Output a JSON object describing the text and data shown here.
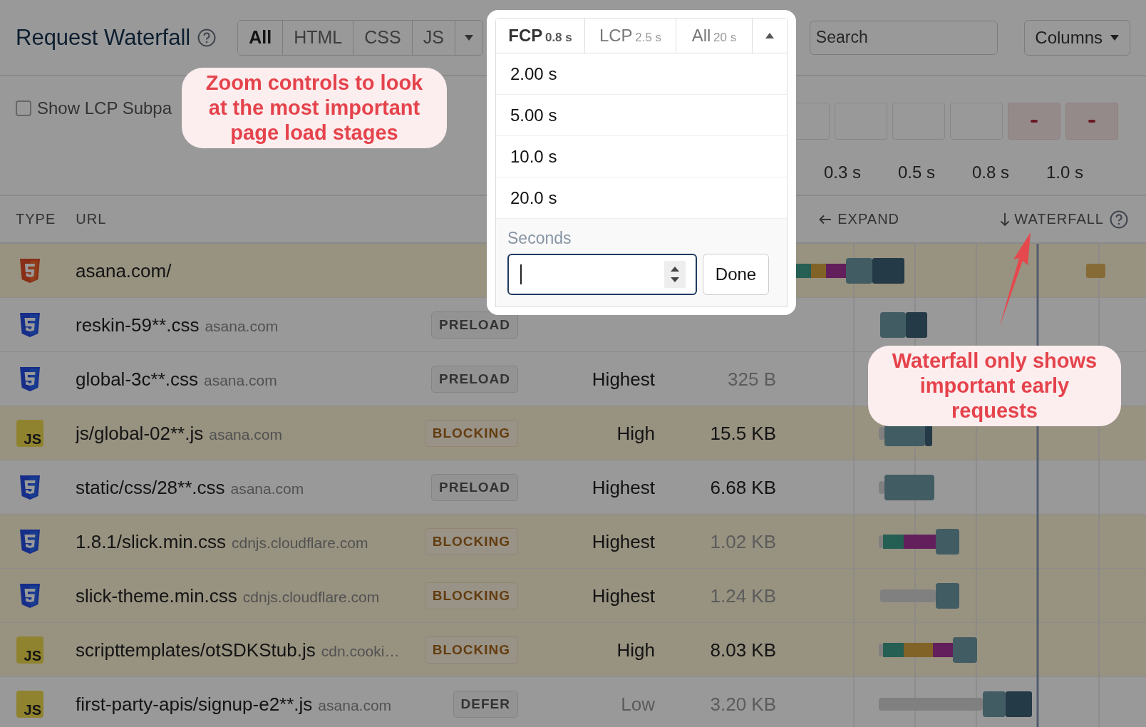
{
  "header": {
    "title": "Request Waterfall",
    "filters": [
      {
        "label": "All",
        "selected": true
      },
      {
        "label": "HTML",
        "selected": false
      },
      {
        "label": "CSS",
        "selected": false
      },
      {
        "label": "JS",
        "selected": false
      }
    ],
    "search": {
      "placeholder": "Search"
    },
    "columns_button": "Columns"
  },
  "lcp_toggle": {
    "label": "Show LCP Subpa",
    "checked": false
  },
  "filmstrip": [
    {
      "kind": "blank"
    },
    {
      "kind": "blank"
    },
    {
      "kind": "blank"
    },
    {
      "kind": "blank"
    },
    {
      "kind": "loading"
    },
    {
      "kind": "loading"
    }
  ],
  "timeline_ticks": [
    "0.3 s",
    "0.5 s",
    "0.8 s",
    "1.0 s"
  ],
  "table": {
    "columns": [
      "TYPE",
      "URL"
    ],
    "expand": "EXPAND",
    "waterfall": "WATERFALL",
    "rows": [
      {
        "kind": "html",
        "url": "asana.com/",
        "highlighted": true
      },
      {
        "kind": "css",
        "url": "reskin-59**.css",
        "domain": "asana.com",
        "badge": {
          "label": "PRELOAD",
          "kind": "preload"
        },
        "highlighted": false
      },
      {
        "kind": "css",
        "url": "global-3c**.css",
        "domain": "asana.com",
        "badge": {
          "label": "PRELOAD",
          "kind": "preload"
        },
        "priority": "Highest",
        "priority_muted": false,
        "size": "325 B",
        "size_muted": true,
        "highlighted": false
      },
      {
        "kind": "js",
        "icon_label": "JS",
        "url": "js/global-02**.js",
        "domain": "asana.com",
        "badge": {
          "label": "BLOCKING",
          "kind": "blocking"
        },
        "priority": "High",
        "priority_muted": false,
        "size": "15.5 KB",
        "size_muted": false,
        "highlighted": true
      },
      {
        "kind": "css",
        "url": "static/css/28**.css",
        "domain": "asana.com",
        "badge": {
          "label": "PRELOAD",
          "kind": "preload"
        },
        "priority": "Highest",
        "priority_muted": false,
        "size": "6.68 KB",
        "size_muted": false,
        "highlighted": false
      },
      {
        "kind": "css",
        "url": "1.8.1/slick.min.css",
        "domain": "cdnjs.cloudflare.com",
        "badge": {
          "label": "BLOCKING",
          "kind": "blocking"
        },
        "priority": "Highest",
        "priority_muted": false,
        "size": "1.02 KB",
        "size_muted": true,
        "highlighted": true
      },
      {
        "kind": "css",
        "url": "slick-theme.min.css",
        "domain": "cdnjs.cloudflare.com",
        "badge": {
          "label": "BLOCKING",
          "kind": "blocking"
        },
        "priority": "Highest",
        "priority_muted": false,
        "size": "1.24 KB",
        "size_muted": true,
        "highlighted": true
      },
      {
        "kind": "js",
        "icon_label": "JS",
        "url": "scripttemplates/otSDKStub.js",
        "domain": "cdn.cooki…",
        "badge": {
          "label": "BLOCKING",
          "kind": "blocking"
        },
        "priority": "High",
        "priority_muted": false,
        "size": "8.03 KB",
        "size_muted": false,
        "highlighted": true
      },
      {
        "kind": "js",
        "icon_label": "JS",
        "url": "first-party-apis/signup-e2**.js",
        "domain": "asana.com",
        "badge": {
          "label": "DEFER",
          "kind": "defer"
        },
        "priority": "Low",
        "priority_muted": true,
        "size": "3.20 KB",
        "size_muted": true,
        "highlighted": false
      }
    ]
  },
  "zoom_menu": {
    "tabs": [
      {
        "label": "FCP",
        "value": "0.8 s",
        "selected": true
      },
      {
        "label": "LCP",
        "value": "2.5 s",
        "selected": false
      },
      {
        "label": "All",
        "value": "20 s",
        "selected": false
      }
    ],
    "options": [
      "2.00 s",
      "5.00 s",
      "10.0 s",
      "20.0 s"
    ],
    "input_label": "Seconds",
    "done": "Done"
  },
  "callouts": [
    "Zoom controls to look at the most important page load stages",
    "Waterfall only shows important early requests"
  ]
}
